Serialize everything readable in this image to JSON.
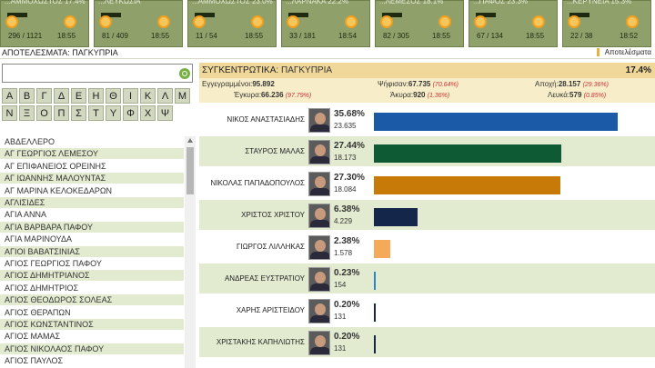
{
  "tiles": [
    {
      "cut": "...ΑΜΜΟΧΩΣΤΟΣ 17.4%",
      "count": "296 / 1121",
      "time": "18:55"
    },
    {
      "cut": "...ΛΕΥΚΩΣΙΑ",
      "count": "81 / 409",
      "time": "18:55"
    },
    {
      "cut": "...ΑΜΜΟΧΩΣΤΟΣ 23.0%",
      "count": "11 / 54",
      "time": "18:55"
    },
    {
      "cut": "...ΛΑΡΝΑΚΑ 22.2%",
      "count": "33 / 181",
      "time": "18:54"
    },
    {
      "cut": "...ΛΕΜΕΣΟΣ 18.1%",
      "count": "82 / 305",
      "time": "18:55"
    },
    {
      "cut": "...ΠΑΦΟΣ 23.3%",
      "count": "67 / 134",
      "time": "18:55"
    },
    {
      "cut": "...ΚΕΡΥΝΕΙΑ 15.3%",
      "count": "22 / 38",
      "time": "18:52"
    }
  ],
  "header": {
    "title": "ΑΠΟΤΕΛΕΣΜΑΤΑ: ΠΑΓΚΥΠΡΙΑ",
    "results_label": "Αποτελέσματα"
  },
  "search": {
    "placeholder": ""
  },
  "letters": [
    "Α",
    "Β",
    "Γ",
    "Δ",
    "Ε",
    "Η",
    "Θ",
    "Ι",
    "Κ",
    "Λ",
    "Μ",
    "Ν",
    "Ξ",
    "Ο",
    "Π",
    "Σ",
    "Τ",
    "Υ",
    "Φ",
    "Χ",
    "Ψ"
  ],
  "list": [
    "ΑΒΔΕΛΛΕΡΟ",
    "ΑΓ ΓΕΩΡΓΙΟΣ ΛΕΜΕΣΟΥ",
    "ΑΓ ΕΠΙΦΑΝΕΙΟΣ ΟΡΕΙΝΗΣ",
    "ΑΓ ΙΩΑΝΝΗΣ ΜΑΛΟΥΝΤΑΣ",
    "ΑΓ ΜΑΡΙΝΑ ΚΕΛΟΚΕΔΑΡΩΝ",
    "ΑΓΛΙΣΙΔΕΣ",
    "ΑΓΙΑ ΑΝΝΑ",
    "ΑΓΙΑ ΒΑΡΒΑΡΑ ΠΑΦΟΥ",
    "ΑΓΙΑ ΜΑΡΙΝΟΥΔΑ",
    "ΑΓΙΟΙ ΒΑΒΑΤΣΙΝΙΑΣ",
    "ΑΓΙΟΣ ΓΕΩΡΓΙΟΣ ΠΑΦΟΥ",
    "ΑΓΙΟΣ ΔΗΜΗΤΡΙΑΝΟΣ",
    "ΑΓΙΟΣ ΔΗΜΗΤΡΙΟΣ",
    "ΑΓΙΟΣ ΘΕΟΔΩΡΟΣ ΣΟΛΕΑΣ",
    "ΑΓΙΟΣ ΘΕΡΑΠΩΝ",
    "ΑΓΙΟΣ ΚΩΝΣΤΑΝΤΙΝΟΣ",
    "ΑΓΙΟΣ ΜΑΜΑΣ",
    "ΑΓΙΟΣ ΝΙΚΟΛΑΟΣ ΠΑΦΟΥ",
    "ΑΓΙΟΣ ΠΑΥΛΟΣ"
  ],
  "summary": {
    "title_prefix": "ΣΥΓΚΕΝΤΡΩΤΙΚΑ:",
    "title_region": "ΠΑΓΚΥΠΡΙΑ",
    "pct": "17.4%",
    "registered_label": "Εγγεγραμμένοι:",
    "registered": "95.892",
    "voted_label": "Ψήφισαν:",
    "voted": "67.735",
    "voted_pct": "(70.64%)",
    "abstain_label": "Αποχή:",
    "abstain": "28.157",
    "abstain_pct": "(29.36%)",
    "valid_label": "Έγκυρα:",
    "valid": "66.236",
    "valid_pct": "(97.79%)",
    "invalid_label": "Άκυρα:",
    "invalid": "920",
    "invalid_pct": "(1.36%)",
    "blank_label": "Λευκά:",
    "blank": "579",
    "blank_pct": "(0.85%)"
  },
  "candidates": [
    {
      "name": "ΝΙΚΟΣ ΑΝΑΣΤΑΣΙΑΔΗΣ",
      "pct": "35.68%",
      "votes": "23.635",
      "share": 35.68,
      "color": "#1a5aa6"
    },
    {
      "name": "ΣΤΑΥΡΟΣ ΜΑΛΑΣ",
      "pct": "27.44%",
      "votes": "18.173",
      "share": 27.44,
      "color": "#0e5a34"
    },
    {
      "name": "ΝΙΚΟΛΑΣ ΠΑΠΑΔΟΠΟΥΛΟΣ",
      "pct": "27.30%",
      "votes": "18.084",
      "share": 27.3,
      "color": "#c77a08"
    },
    {
      "name": "ΧΡΙΣΤΟΣ ΧΡΙΣΤΟΥ",
      "pct": "6.38%",
      "votes": "4.229",
      "share": 6.38,
      "color": "#14264a"
    },
    {
      "name": "ΓΙΩΡΓΟΣ ΛΙΛΛΗΚΑΣ",
      "pct": "2.38%",
      "votes": "1.578",
      "share": 2.38,
      "color": "#f5a95a"
    },
    {
      "name": "ΑΝΔΡΕΑΣ ΕΥΣΤΡΑΤΙΟΥ",
      "pct": "0.23%",
      "votes": "154",
      "share": 0.23,
      "color": "#2a86c8"
    },
    {
      "name": "ΧΑΡΗΣ ΑΡΙΣΤΕΙΔΟΥ",
      "pct": "0.20%",
      "votes": "131",
      "share": 0.2,
      "color": "#14264a"
    },
    {
      "name": "ΧΡΙΣΤΑΚΗΣ ΚΑΠΗΛΙΩΤΗΣ",
      "pct": "0.20%",
      "votes": "131",
      "share": 0.2,
      "color": "#14264a"
    }
  ]
}
